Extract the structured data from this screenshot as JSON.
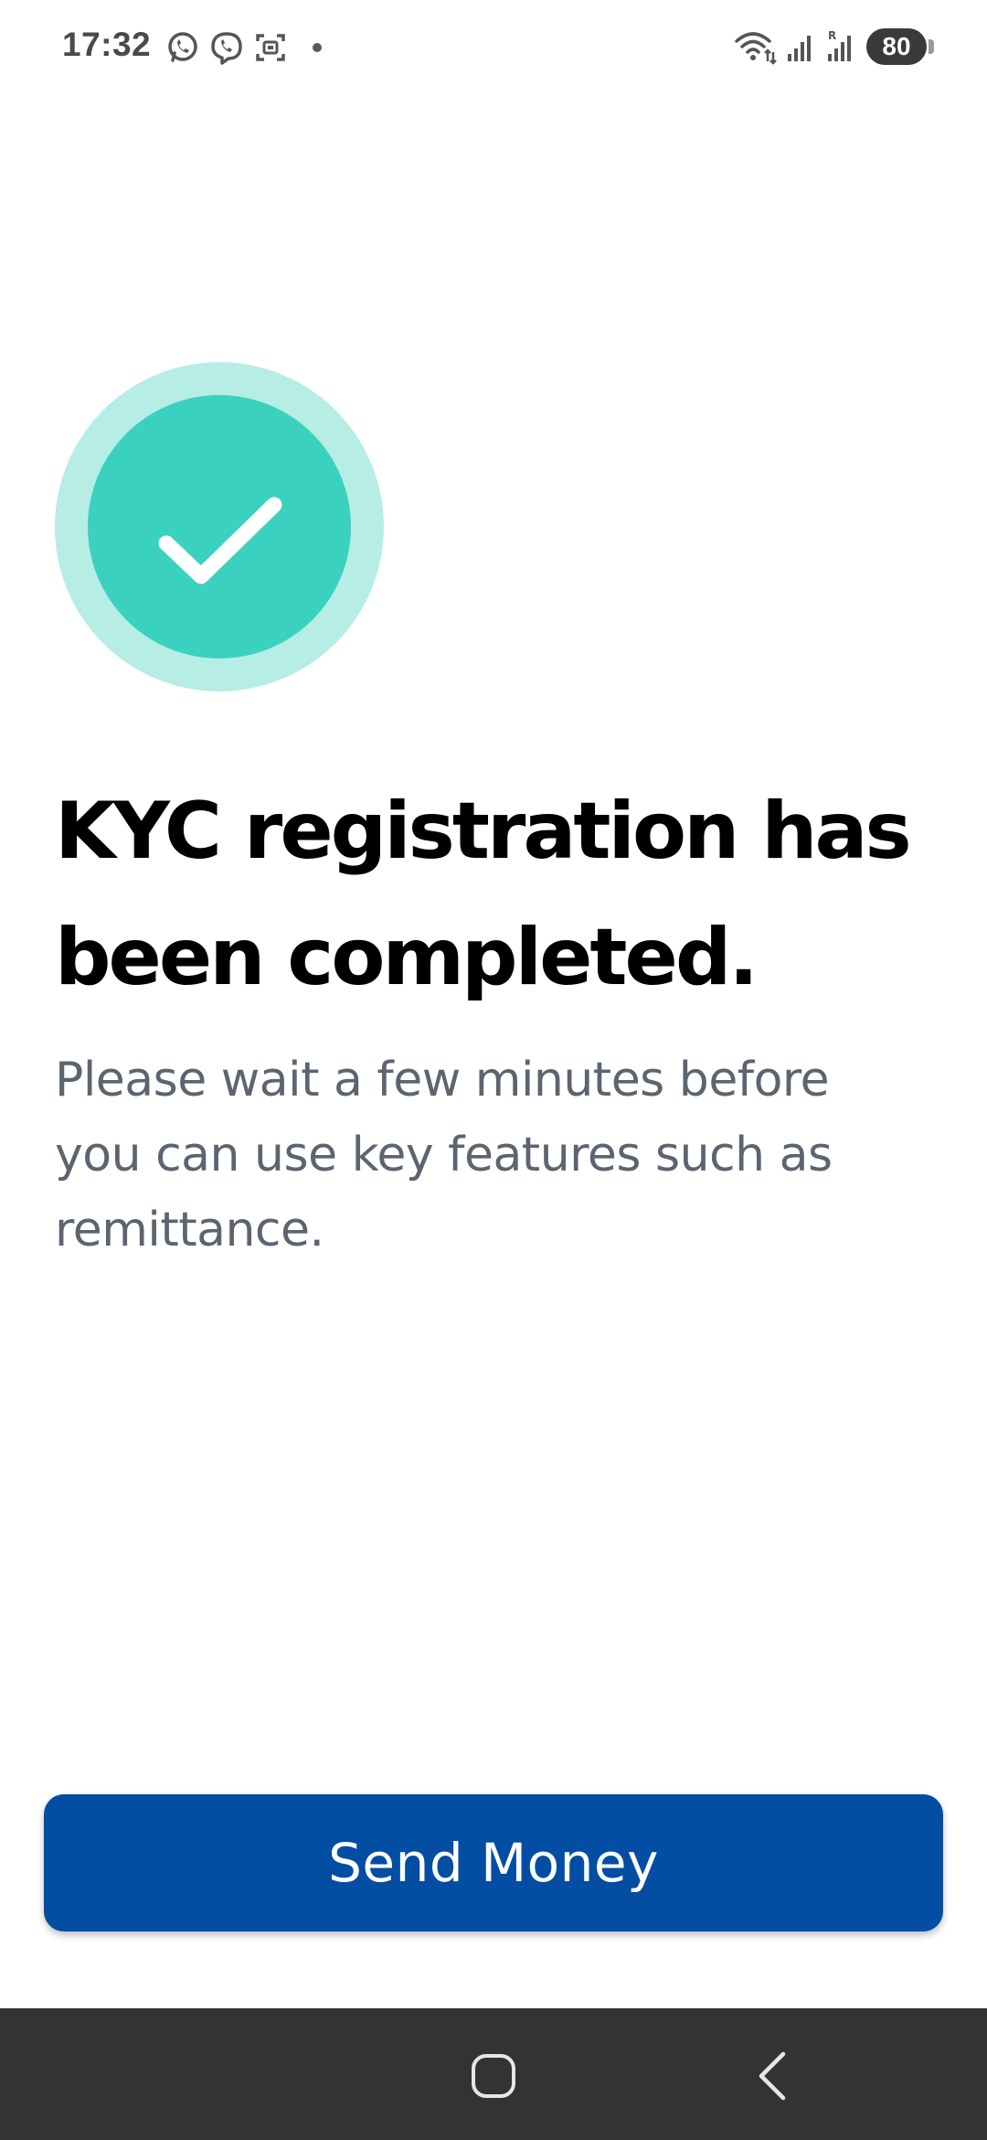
{
  "status_bar": {
    "time": "17:32",
    "battery_level": "80",
    "left_icons": [
      "whatsapp-icon",
      "viber-icon",
      "screenshot-icon",
      "notification-dot"
    ],
    "right_icons": [
      "wifi-icon",
      "signal-icon",
      "signal-roaming-icon",
      "battery-icon"
    ]
  },
  "success_badge": {
    "icon": "check-icon",
    "outer_color": "#b6ede5",
    "inner_color": "#3ad1bf",
    "check_color": "#ffffff"
  },
  "headline": "KYC registration has been completed.",
  "subtext": "Please wait a few minutes before you can use key features such as remittance.",
  "primary_button": {
    "label": "Send Money",
    "color": "#034da2"
  },
  "nav_bar": {
    "icons": [
      "home-icon",
      "back-icon"
    ],
    "background": "#333333"
  }
}
